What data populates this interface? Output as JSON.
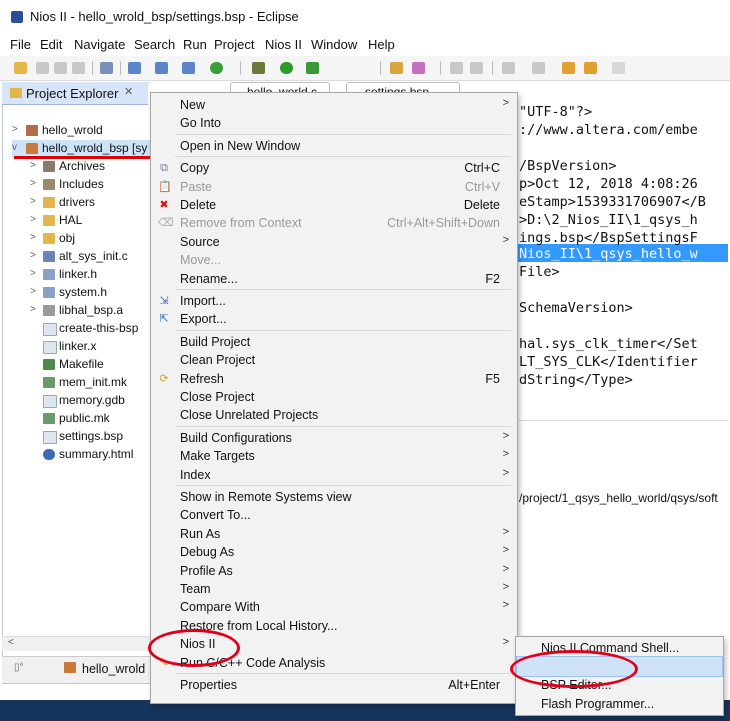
{
  "window": {
    "title": "Nios II - hello_wrold_bsp/settings.bsp - Eclipse"
  },
  "menubar": [
    "File",
    "Edit",
    "Navigate",
    "Search",
    "Run",
    "Project",
    "Nios II",
    "Window",
    "Help"
  ],
  "explorer": {
    "tab_label": "Project Explorer",
    "items": [
      {
        "label": "hello_wrold",
        "arrow": ">"
      },
      {
        "label": "hello_wrold_bsp [sy",
        "arrow": "v"
      },
      {
        "label": "Archives",
        "arrow": ">"
      },
      {
        "label": "Includes",
        "arrow": ">"
      },
      {
        "label": "drivers",
        "arrow": ">"
      },
      {
        "label": "HAL",
        "arrow": ">"
      },
      {
        "label": "obj",
        "arrow": ">"
      },
      {
        "label": "alt_sys_init.c",
        "arrow": ">"
      },
      {
        "label": "linker.h",
        "arrow": ">"
      },
      {
        "label": "system.h",
        "arrow": ">"
      },
      {
        "label": "libhal_bsp.a",
        "arrow": ">"
      },
      {
        "label": "create-this-bsp",
        "arrow": ""
      },
      {
        "label": "linker.x",
        "arrow": ""
      },
      {
        "label": "Makefile",
        "arrow": ""
      },
      {
        "label": "mem_init.mk",
        "arrow": ""
      },
      {
        "label": "memory.gdb",
        "arrow": ""
      },
      {
        "label": "public.mk",
        "arrow": ""
      },
      {
        "label": "settings.bsp",
        "arrow": ""
      },
      {
        "label": "summary.html",
        "arrow": ""
      }
    ],
    "bottom_label": "hello_wrold"
  },
  "editor": {
    "tabs": [
      "hello_world.c",
      "settings.bsp"
    ],
    "lines": [
      "\"UTF-8\"?>",
      "://www.altera.com/embe",
      "/BspVersion>",
      "p>Oct 12, 2018 4:08:26",
      "eStamp>1539331706907</B",
      ">D:\\2_Nios_II\\1_qsys_h",
      "ings.bsp</BspSettingsF",
      "Nios_II\\1_qsys_hello_w",
      "File>",
      "SchemaVersion>",
      "hal.sys_clk_timer</Set",
      "LT_SYS_CLK</Identifier",
      "dString</Type>"
    ],
    "path_line": "/project/1_qsys_hello_world/qsys/soft"
  },
  "context_menu": {
    "items": [
      {
        "label": "New",
        "shortcut": "",
        "arrow": ">",
        "icon": "",
        "disabled": false
      },
      {
        "label": "Go Into",
        "shortcut": "",
        "arrow": "",
        "icon": "",
        "disabled": false
      },
      {
        "sep": true
      },
      {
        "label": "Open in New Window",
        "shortcut": "",
        "arrow": "",
        "icon": "",
        "disabled": false
      },
      {
        "sep": true
      },
      {
        "label": "Copy",
        "shortcut": "Ctrl+C",
        "arrow": "",
        "icon": "copy",
        "disabled": false
      },
      {
        "label": "Paste",
        "shortcut": "Ctrl+V",
        "arrow": "",
        "icon": "paste",
        "disabled": true
      },
      {
        "label": "Delete",
        "shortcut": "Delete",
        "arrow": "",
        "icon": "delete",
        "disabled": false
      },
      {
        "label": "Remove from Context",
        "shortcut": "Ctrl+Alt+Shift+Down",
        "arrow": "",
        "icon": "remove",
        "disabled": true
      },
      {
        "label": "Source",
        "shortcut": "",
        "arrow": ">",
        "icon": "",
        "disabled": false
      },
      {
        "label": "Move...",
        "shortcut": "",
        "arrow": "",
        "icon": "",
        "disabled": true
      },
      {
        "label": "Rename...",
        "shortcut": "F2",
        "arrow": "",
        "icon": "",
        "disabled": false
      },
      {
        "sep": true
      },
      {
        "label": "Import...",
        "shortcut": "",
        "arrow": "",
        "icon": "import",
        "disabled": false
      },
      {
        "label": "Export...",
        "shortcut": "",
        "arrow": "",
        "icon": "export",
        "disabled": false
      },
      {
        "sep": true
      },
      {
        "label": "Build Project",
        "shortcut": "",
        "arrow": "",
        "icon": "",
        "disabled": false
      },
      {
        "label": "Clean Project",
        "shortcut": "",
        "arrow": "",
        "icon": "",
        "disabled": false
      },
      {
        "label": "Refresh",
        "shortcut": "F5",
        "arrow": "",
        "icon": "refresh",
        "disabled": false
      },
      {
        "label": "Close Project",
        "shortcut": "",
        "arrow": "",
        "icon": "",
        "disabled": false
      },
      {
        "label": "Close Unrelated Projects",
        "shortcut": "",
        "arrow": "",
        "icon": "",
        "disabled": false
      },
      {
        "sep": true
      },
      {
        "label": "Build Configurations",
        "shortcut": "",
        "arrow": ">",
        "icon": "",
        "disabled": false
      },
      {
        "label": "Make Targets",
        "shortcut": "",
        "arrow": ">",
        "icon": "",
        "disabled": false
      },
      {
        "label": "Index",
        "shortcut": "",
        "arrow": ">",
        "icon": "",
        "disabled": false
      },
      {
        "sep": true
      },
      {
        "label": "Show in Remote Systems view",
        "shortcut": "",
        "arrow": "",
        "icon": "",
        "disabled": false
      },
      {
        "label": "Convert To...",
        "shortcut": "",
        "arrow": "",
        "icon": "",
        "disabled": false
      },
      {
        "label": "Run As",
        "shortcut": "",
        "arrow": ">",
        "icon": "",
        "disabled": false
      },
      {
        "label": "Debug As",
        "shortcut": "",
        "arrow": ">",
        "icon": "",
        "disabled": false
      },
      {
        "label": "Profile As",
        "shortcut": "",
        "arrow": ">",
        "icon": "",
        "disabled": false
      },
      {
        "label": "Team",
        "shortcut": "",
        "arrow": ">",
        "icon": "",
        "disabled": false
      },
      {
        "label": "Compare With",
        "shortcut": "",
        "arrow": ">",
        "icon": "",
        "disabled": false
      },
      {
        "label": "Restore from Local History...",
        "shortcut": "",
        "arrow": "",
        "icon": "",
        "disabled": false
      },
      {
        "label": "Nios II",
        "shortcut": "",
        "arrow": ">",
        "icon": "",
        "disabled": false
      },
      {
        "label": "Run C/C++ Code Analysis",
        "shortcut": "",
        "arrow": "",
        "icon": "analysis",
        "disabled": false
      },
      {
        "sep": true
      },
      {
        "label": "Properties",
        "shortcut": "Alt+Enter",
        "arrow": "",
        "icon": "",
        "disabled": false
      }
    ]
  },
  "submenu": {
    "items": [
      "Nios II Command Shell...",
      "Generate BSP",
      "BSP Editor...",
      "Flash Programmer..."
    ]
  },
  "colors": {
    "annotation_red": "#e00000",
    "highlight": "#cfe2f7",
    "selection": "#3399ff"
  }
}
